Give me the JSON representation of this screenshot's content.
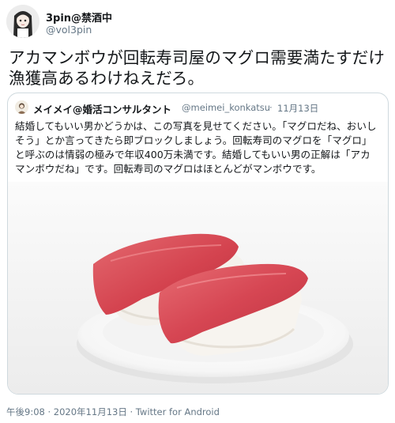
{
  "tweet": {
    "display_name": "3pin@禁酒中",
    "handle": "@vol3pin",
    "text": "アカマンボウが回転寿司屋のマグロ需要満たすだけ漁獲高あるわけねえだろ。",
    "timestamp": "午後9:08 · 2020年11月13日 · Twitter for Android"
  },
  "quoted": {
    "display_name": "メイメイ@婚活コンサルタント",
    "handle": "@meimei_konkatsu",
    "separator": "·",
    "date": "11月13日",
    "text": "結婚してもいい男かどうかは、この写真を見せてください。「マグロだね、おいしそう」とか言ってきたら即ブロックしましょう。回転寿司のマグロを「マグロ」と呼ぶのは情弱の極みで年収400万未満です。結婚してもいい男の正解は「アカマンボウだね」です。回転寿司のマグロはほとんどがマンボウです。",
    "image_subject": "tuna-nigiri-sushi-on-plate"
  },
  "colors": {
    "text_primary": "#14171a",
    "text_secondary": "#657786",
    "border": "#cfd9de",
    "tuna": "#d9505a",
    "rice": "#f6f3ee",
    "plate": "#ffffff"
  }
}
